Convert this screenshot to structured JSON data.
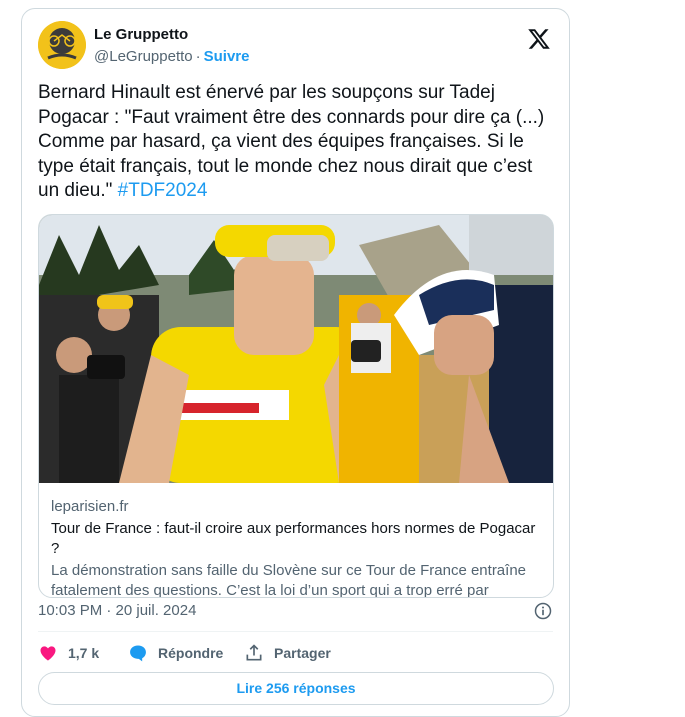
{
  "author": {
    "display_name": "Le Gruppetto",
    "handle": "@LeGruppetto",
    "separator": "·",
    "follow_label": "Suivre"
  },
  "tweet": {
    "text": "Bernard Hinault est énervé par les soupçons sur Tadej Pogacar : \"Faut vraiment être des connards pour dire ça (...) Comme par hasard, ça vient des équipes françaises. Si le type était français, tout le monde chez nous dirait que c’est un dieu.\" ",
    "hashtag": "#TDF2024"
  },
  "link_card": {
    "domain": "leparisien.fr",
    "title": "Tour de France : faut-il croire aux performances hors normes de Pogacar ?",
    "description": "La démonstration sans faille du Slovène sur ce Tour de France entraîne fatalement des questions. C’est la loi d’un sport qui a trop erré par"
  },
  "timestamp": "10:03 PM · 20 juil. 2024",
  "actions": {
    "likes_count": "1,7 k",
    "reply_label": "Répondre",
    "share_label": "Partager"
  },
  "replies_button_label": "Lire 256 réponses",
  "colors": {
    "accent": "#1d9bf0",
    "like": "#f91880",
    "jersey_yellow": "#f5d800",
    "secondary_text": "#536471"
  },
  "icons": [
    "x-logo-icon",
    "info-icon",
    "heart-icon",
    "reply-bubble-icon",
    "share-icon"
  ]
}
